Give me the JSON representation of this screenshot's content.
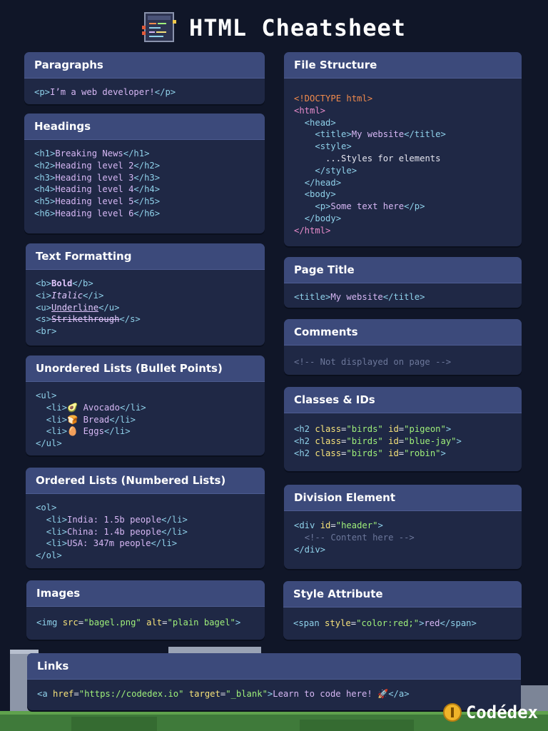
{
  "header": {
    "title": "HTML Cheatsheet",
    "icon": "code-terminal-icon"
  },
  "cards": {
    "paragraphs": {
      "title": "Paragraphs",
      "code": {
        "open": "<p>",
        "text": "I’m a web developer!",
        "close": "</p>"
      }
    },
    "headings": {
      "title": "Headings",
      "lines": [
        {
          "open": "<h1>",
          "text": "Breaking News",
          "close": "</h1>"
        },
        {
          "open": "<h2>",
          "text": "Heading level 2",
          "close": "</h2>"
        },
        {
          "open": "<h3>",
          "text": "Heading level 3",
          "close": "</h3>"
        },
        {
          "open": "<h4>",
          "text": "Heading level 4",
          "close": "</h4>"
        },
        {
          "open": "<h5>",
          "text": "Heading level 5",
          "close": "</h5>"
        },
        {
          "open": "<h6>",
          "text": "Heading level 6",
          "close": "</h6>"
        }
      ]
    },
    "text_formatting": {
      "title": "Text Formatting",
      "lines": [
        {
          "open": "<b>",
          "text": "Bold",
          "close": "</b>"
        },
        {
          "open": "<i>",
          "text": "Italic",
          "close": "</i>"
        },
        {
          "open": "<u>",
          "text": "Underline",
          "close": "</u>"
        },
        {
          "open": "<s>",
          "text": "Strikethrough",
          "close": "</s>"
        }
      ],
      "br": "<br>"
    },
    "unordered_lists": {
      "title": "Unordered Lists (Bullet Points)",
      "open": "<ul>",
      "items": [
        {
          "open": "<li>",
          "emoji": "🥑",
          "text": " Avocado",
          "close": "</li>"
        },
        {
          "open": "<li>",
          "emoji": "🍞",
          "text": " Bread",
          "close": "</li>"
        },
        {
          "open": "<li>",
          "emoji": "🥚",
          "text": " Eggs",
          "close": "</li>"
        }
      ],
      "close": "</ul>"
    },
    "ordered_lists": {
      "title": "Ordered Lists (Numbered Lists)",
      "open": "<ol>",
      "items": [
        {
          "open": "<li>",
          "text": "India: 1.5b people",
          "close": "</li>"
        },
        {
          "open": "<li>",
          "text": "China: 1.4b people",
          "close": "</li>"
        },
        {
          "open": "<li>",
          "text": "USA: 347m people",
          "close": "</li>"
        }
      ],
      "close": "</ol>"
    },
    "images": {
      "title": "Images",
      "tag_open": "<img",
      "attr1": "src",
      "val1": "\"bagel.png\"",
      "attr2": "alt",
      "val2": "\"plain bagel\"",
      "tag_close": ">"
    },
    "links": {
      "title": "Links",
      "tag_open": "<a",
      "attr1": "href",
      "val1": "\"https://codedex.io\"",
      "attr2": "target",
      "val2": "\"_blank\"",
      "gt": ">",
      "text": "Learn to code here! 🚀",
      "close": "</a>"
    },
    "file_structure": {
      "title": "File Structure",
      "doctype": "<!DOCTYPE html>",
      "html_open": "<html>",
      "head_open": "<head>",
      "title_open": "<title>",
      "title_text": "My website",
      "title_close": "</title>",
      "style_open": "<style>",
      "style_text": "...Styles for elements",
      "style_close": "</style>",
      "head_close": "</head>",
      "body_open": "<body>",
      "p_open": "<p>",
      "p_text": "Some text here",
      "p_close": "</p>",
      "body_close": "</body>",
      "html_close": "</html>"
    },
    "page_title": {
      "title": "Page Title",
      "open": "<title>",
      "text": "My website",
      "close": "</title>"
    },
    "comments": {
      "title": "Comments",
      "text": "<!-- Not displayed on page -->"
    },
    "classes_ids": {
      "title": "Classes & IDs",
      "lines": [
        {
          "tag": "<h2",
          "class_attr": "class",
          "class_val": "\"birds\"",
          "id_attr": "id",
          "id_val": "\"pigeon\"",
          "end": ">"
        },
        {
          "tag": "<h2",
          "class_attr": "class",
          "class_val": "\"birds\"",
          "id_attr": "id",
          "id_val": "\"blue-jay\"",
          "end": ">"
        },
        {
          "tag": "<h2",
          "class_attr": "class",
          "class_val": "\"birds\"",
          "id_attr": "id",
          "id_val": "\"robin\"",
          "end": ">"
        }
      ]
    },
    "division": {
      "title": "Division Element",
      "open": "<div",
      "attr": "id",
      "val": "\"header\"",
      "gt": ">",
      "comment": "<!-- Content here -->",
      "close": "</div>"
    },
    "style_attribute": {
      "title": "Style Attribute",
      "open": "<span",
      "attr": "style",
      "val": "\"color:red;\"",
      "gt": ">",
      "text": "red",
      "close": "</span>"
    }
  },
  "footer": {
    "logo_text": "Codédex",
    "logo_icon": "coin-icon"
  }
}
